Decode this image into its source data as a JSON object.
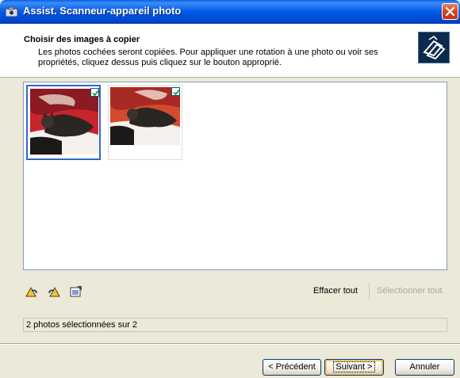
{
  "window": {
    "title": "Assist. Scanneur-appareil photo"
  },
  "header": {
    "title": "Choisir des images à copier",
    "description": "Les photos cochées seront copiées. Pour appliquer une rotation à une photo ou voir ses propriétés, cliquez dessus puis cliquez sur le bouton approprié."
  },
  "thumbnails": [
    {
      "checked": true,
      "selected": true
    },
    {
      "checked": true,
      "selected": false
    }
  ],
  "toolbar": {
    "rotate_right_icon": "rotate-right-icon",
    "rotate_left_icon": "rotate-left-icon",
    "properties_icon": "properties-icon",
    "clear_all": "Effacer tout",
    "select_all": "Sélectionner tout"
  },
  "status": {
    "text": "2 photos sélectionnées sur 2"
  },
  "buttons": {
    "back": "< Précédent",
    "next": "Suivant >",
    "cancel": "Annuler"
  },
  "colors": {
    "titlebar": "#0058e5",
    "selection": "#3169c6",
    "disabled_text": "#aca899",
    "check": "#21a121"
  }
}
